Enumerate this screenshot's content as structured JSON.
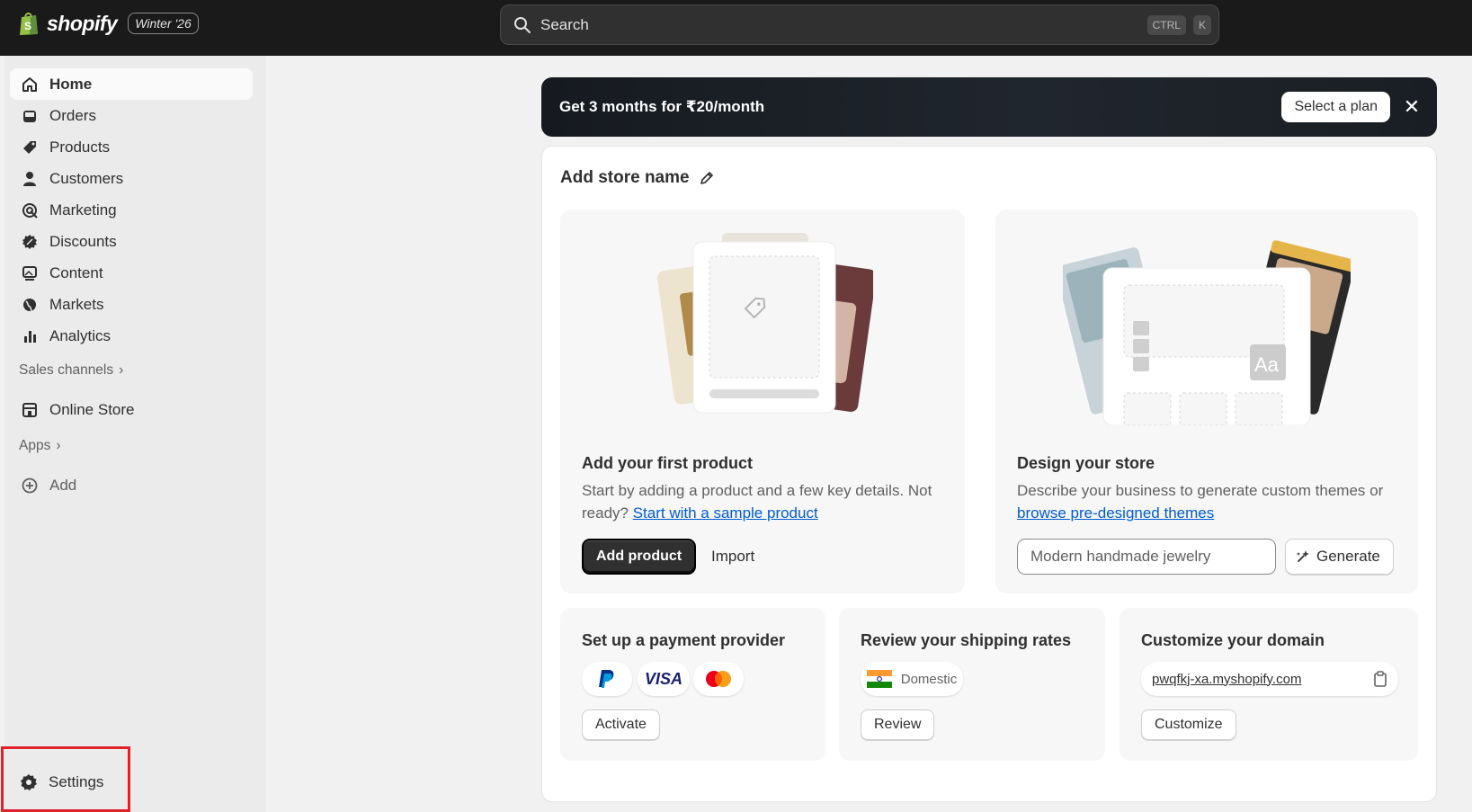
{
  "topbar": {
    "brand": "shopify",
    "edition": "Winter '26",
    "search_label": "Search",
    "shortcut_ctrl": "CTRL",
    "shortcut_k": "K"
  },
  "sidebar": {
    "items": [
      {
        "label": "Home",
        "icon": "home-icon",
        "active": true
      },
      {
        "label": "Orders",
        "icon": "inbox-icon"
      },
      {
        "label": "Products",
        "icon": "tag-icon"
      },
      {
        "label": "Customers",
        "icon": "person-icon"
      },
      {
        "label": "Marketing",
        "icon": "target-icon"
      },
      {
        "label": "Discounts",
        "icon": "discount-icon"
      },
      {
        "label": "Content",
        "icon": "image-icon"
      },
      {
        "label": "Markets",
        "icon": "globe-icon"
      },
      {
        "label": "Analytics",
        "icon": "bar-chart-icon"
      }
    ],
    "sales_channels_label": "Sales channels",
    "online_store_label": "Online Store",
    "apps_label": "Apps",
    "add_label": "Add",
    "settings_label": "Settings"
  },
  "banner": {
    "text": "Get 3 months for ₹20/month",
    "cta": "Select a plan",
    "close": "✕"
  },
  "store": {
    "name_prompt": "Add store name"
  },
  "first_product": {
    "title": "Add your first product",
    "desc": "Start by adding a product and a few key details. Not ready? ",
    "link": "Start with a sample product",
    "primary": "Add product",
    "secondary": "Import"
  },
  "design_store": {
    "title": "Design your store",
    "desc": "Describe your business to generate custom themes or ",
    "link": "browse pre-designed themes",
    "input_value": "Modern handmade jewelry",
    "generate": "Generate"
  },
  "payment": {
    "title": "Set up a payment provider",
    "visa": "VISA",
    "action": "Activate"
  },
  "shipping": {
    "title": "Review your shipping rates",
    "zone": "Domestic",
    "action": "Review"
  },
  "domain": {
    "title": "Customize your domain",
    "url": "pwqfkj-xa.myshopify.com",
    "action": "Customize"
  },
  "colors": {
    "topbar": "#1a1a1a",
    "sidebar": "#ebebeb",
    "link": "#005bd3",
    "highlight": "#e0202a"
  }
}
